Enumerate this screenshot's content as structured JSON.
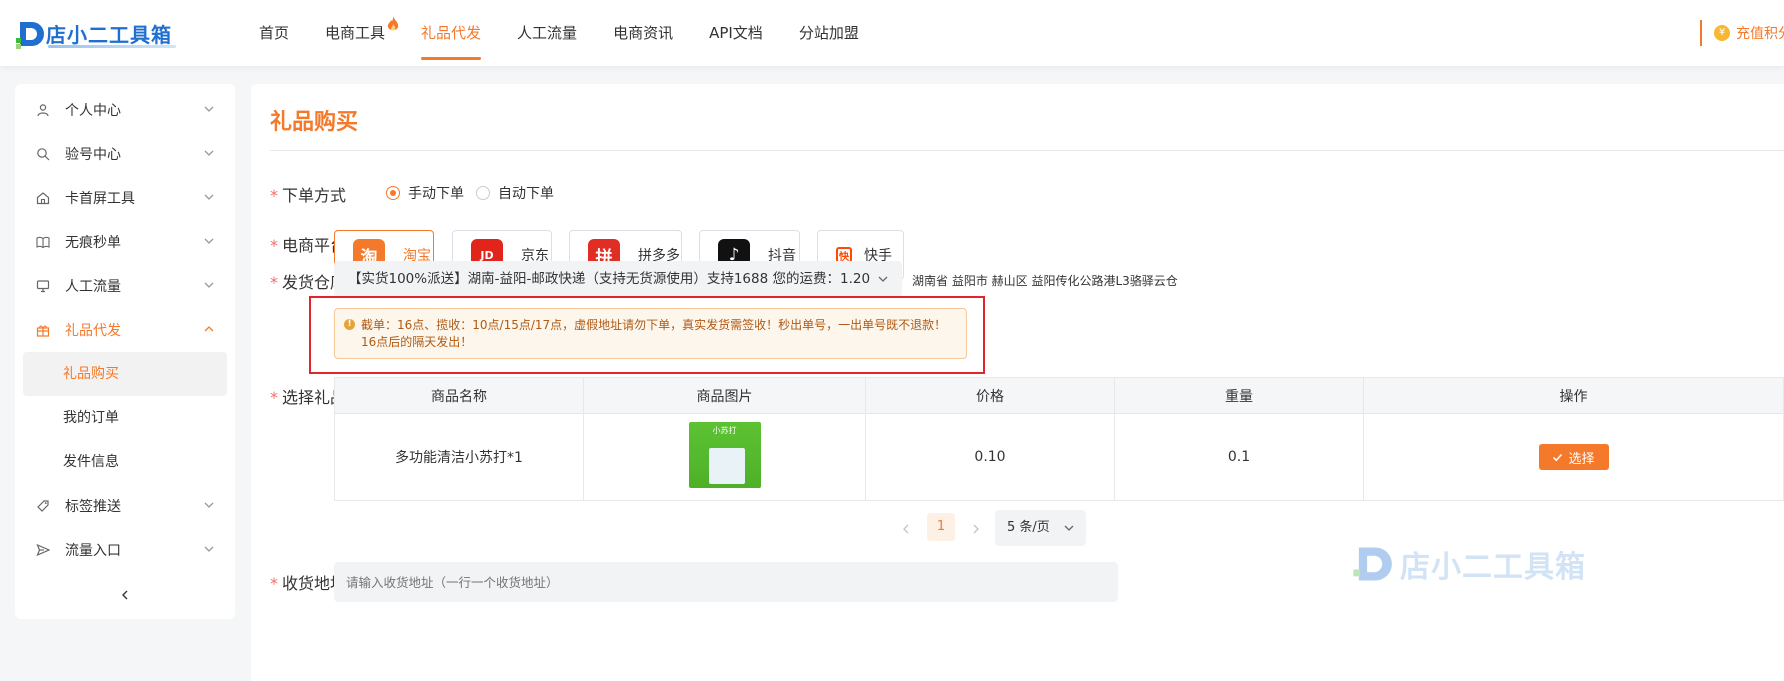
{
  "header": {
    "logo_text": "店小二工具箱",
    "nav": [
      {
        "label": "首页"
      },
      {
        "label": "电商工具"
      },
      {
        "label": "礼品代发"
      },
      {
        "label": "人工流量"
      },
      {
        "label": "电商资讯"
      },
      {
        "label": "API文档"
      },
      {
        "label": "分站加盟"
      }
    ],
    "active_nav": "礼品代发",
    "recharge_label": "充值积分"
  },
  "sidebar": {
    "items": [
      {
        "label": "个人中心",
        "icon": "user-icon"
      },
      {
        "label": "验号中心",
        "icon": "search-icon"
      },
      {
        "label": "卡首屏工具",
        "icon": "home-icon"
      },
      {
        "label": "无痕秒单",
        "icon": "book-icon"
      },
      {
        "label": "人工流量",
        "icon": "monitor-icon"
      },
      {
        "label": "礼品代发",
        "icon": "gift-icon"
      },
      {
        "label": "标签推送",
        "icon": "tag-icon"
      },
      {
        "label": "流量入口",
        "icon": "send-icon"
      }
    ],
    "sub_items": [
      {
        "label": "礼品购买"
      },
      {
        "label": "我的订单"
      },
      {
        "label": "发件信息"
      }
    ],
    "active_sub": "礼品购买"
  },
  "main": {
    "title": "礼品购买",
    "order_mode": {
      "label": "下单方式",
      "options": [
        {
          "label": "手动下单",
          "checked": true
        },
        {
          "label": "自动下单",
          "checked": false
        }
      ]
    },
    "platform": {
      "label": "电商平台",
      "options": [
        {
          "label": "淘宝",
          "icon_char": "淘",
          "color": "#f5792a",
          "active": true
        },
        {
          "label": "京东",
          "icon_char": "JD",
          "color": "#e1251b",
          "active": false
        },
        {
          "label": "拼多多",
          "icon_char": "拼",
          "color": "#e02e24",
          "active": false
        },
        {
          "label": "抖音",
          "icon_char": "♪",
          "color": "#111111",
          "active": false
        },
        {
          "label": "快手",
          "icon_char": "快",
          "color": "#ff4906",
          "active": false
        }
      ]
    },
    "warehouse": {
      "label": "发货仓库",
      "value": "【实货100%派送】湖南-益阳-邮政快递（支持无货源使用）支持1688 您的运费：1.20",
      "address": "湖南省 益阳市 赫山区 益阳传化公路港L3骆驿云仓"
    },
    "notice": "截单：16点、揽收：10点/15点/17点，虚假地址请勿下单，真实发货需签收！秒出单号，一出单号既不退款！16点后的隔天发出！",
    "gift": {
      "label": "选择礼品",
      "columns": [
        "商品名称",
        "商品图片",
        "价格",
        "重量",
        "操作"
      ],
      "rows": [
        {
          "name": "多功能清洁小苏打*1",
          "image_caption": "小苏打",
          "price": "0.10",
          "weight": "0.1",
          "action": "选择"
        }
      ]
    },
    "pagination": {
      "current_page": "1",
      "page_size": "5 条/页"
    },
    "address": {
      "label": "收货地址",
      "placeholder": "请输入收货地址（一行一个收货地址）"
    }
  },
  "watermark_text": "店小二工具箱",
  "colors": {
    "accent": "#f5792a",
    "required": "#f56c6c",
    "highlight_box": "#e0262c",
    "brand_blue": "#1f6fd0"
  }
}
